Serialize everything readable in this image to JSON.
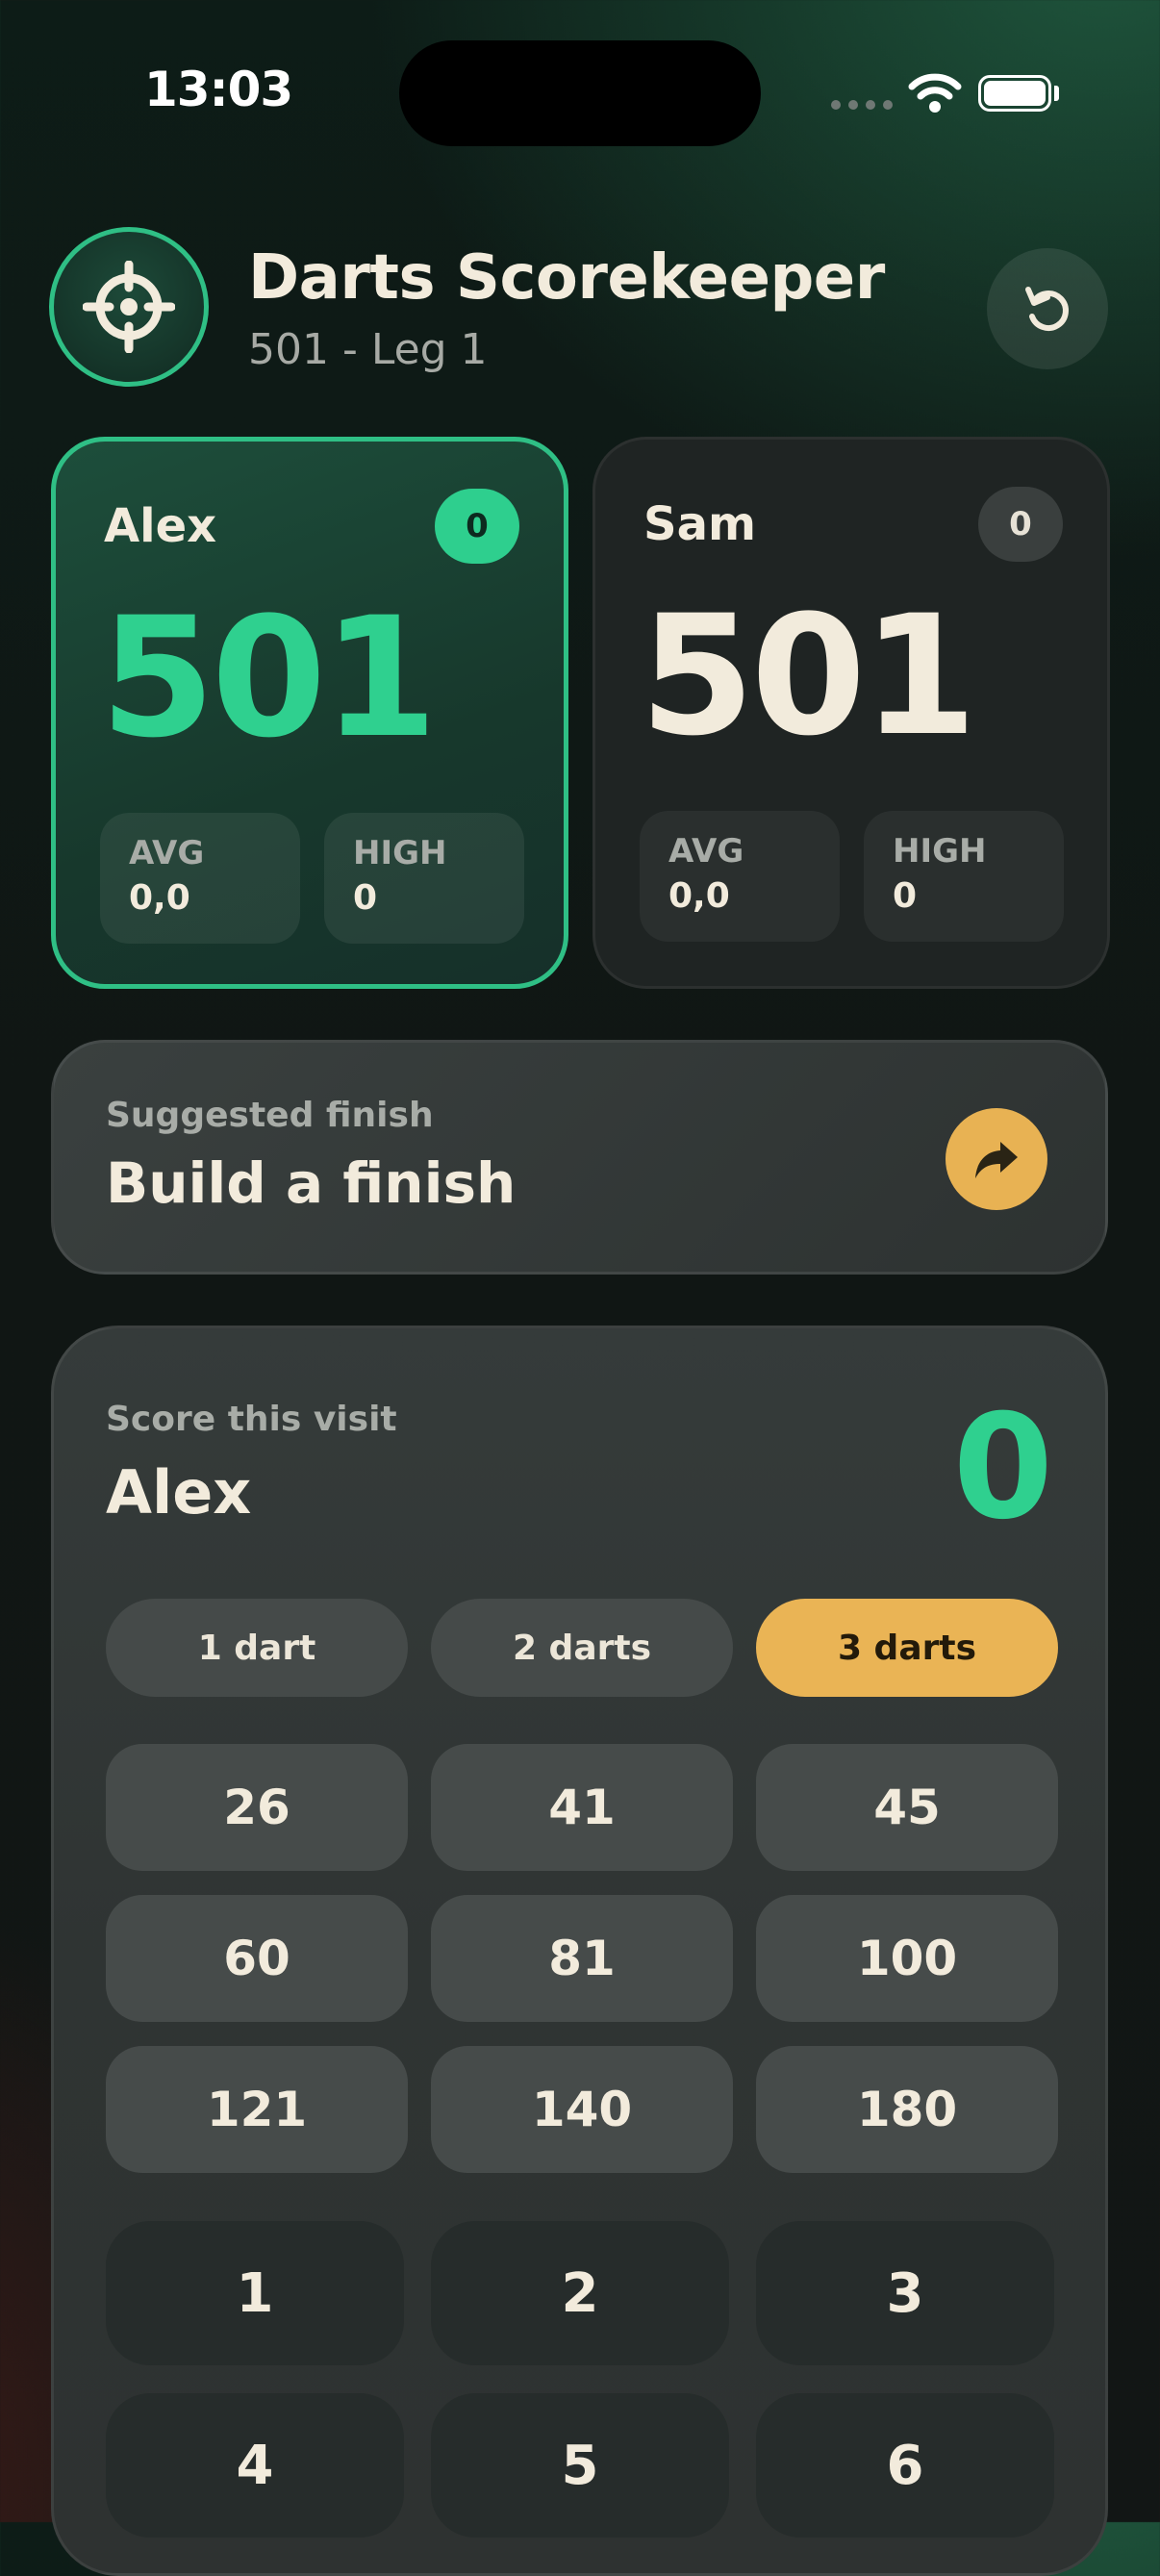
{
  "status_bar": {
    "time": "13:03"
  },
  "header": {
    "title": "Darts Scorekeeper",
    "subtitle": "501 - Leg 1",
    "logo_icon": "crosshair-icon",
    "reset_icon": "reset-icon"
  },
  "players": [
    {
      "name": "Alex",
      "legs": "0",
      "score": "501",
      "avg_label": "AVG",
      "avg": "0,0",
      "high_label": "HIGH",
      "high": "0",
      "active": true
    },
    {
      "name": "Sam",
      "legs": "0",
      "score": "501",
      "avg_label": "AVG",
      "avg": "0,0",
      "high_label": "HIGH",
      "high": "0",
      "active": false
    }
  ],
  "finish": {
    "label": "Suggested finish",
    "title": "Build a finish",
    "icon": "forward-arrow-icon"
  },
  "visit": {
    "label": "Score this visit",
    "player": "Alex",
    "score": "0",
    "dart_options": [
      "1 dart",
      "2 darts",
      "3 darts"
    ],
    "selected_darts": "3 darts",
    "quick_scores": [
      "26",
      "41",
      "45",
      "60",
      "81",
      "100",
      "121",
      "140",
      "180"
    ],
    "keypad": [
      "1",
      "2",
      "3",
      "4",
      "5",
      "6"
    ]
  },
  "colors": {
    "accent_green": "#2fd08f",
    "accent_gold": "#eab455",
    "text": "#f2ebdc"
  }
}
